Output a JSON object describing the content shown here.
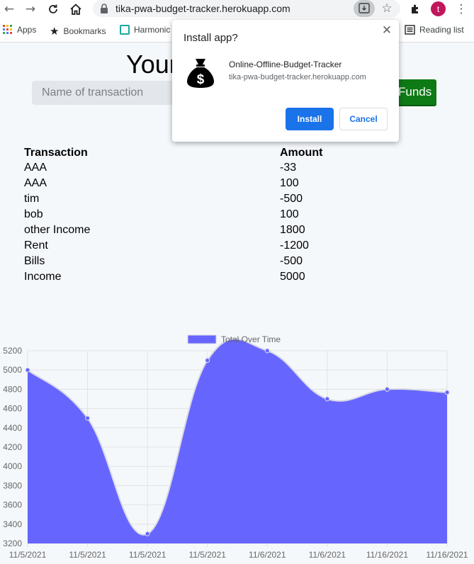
{
  "browser": {
    "url": "tika-pwa-budget-tracker.herokuapp.com",
    "profile_initial": "t",
    "bookmarks": [
      {
        "label": "Apps",
        "icon": "apps-grid-icon"
      },
      {
        "label": "Bookmarks",
        "icon": "star-icon"
      },
      {
        "label": "Harmonic",
        "icon": "harmonic-favicon-icon"
      }
    ],
    "reading_list_label": "Reading list"
  },
  "page": {
    "title": "Your",
    "name_placeholder": "Name of transaction",
    "add_funds_label": "Funds",
    "table": {
      "headers": [
        "Transaction",
        "Amount"
      ],
      "rows": [
        {
          "name": "AAA",
          "amount": "-33"
        },
        {
          "name": "AAA",
          "amount": "100"
        },
        {
          "name": "tim",
          "amount": "-500"
        },
        {
          "name": "bob",
          "amount": "100"
        },
        {
          "name": "other Income",
          "amount": "1800"
        },
        {
          "name": "Rent",
          "amount": "-1200"
        },
        {
          "name": "Bills",
          "amount": "-500"
        },
        {
          "name": "Income",
          "amount": "5000"
        }
      ]
    }
  },
  "chart_data": {
    "type": "area",
    "title": "",
    "legend": "top-center",
    "series": [
      {
        "name": "Total Over Time",
        "color": "#6666ff",
        "values": [
          5000,
          4500,
          3300,
          5100,
          5200,
          4700,
          4800,
          4767
        ]
      }
    ],
    "categories": [
      "11/5/2021",
      "11/5/2021",
      "11/5/2021",
      "11/5/2021",
      "11/6/2021",
      "11/6/2021",
      "11/16/2021",
      "11/16/2021"
    ],
    "y_ticks": [
      "5200",
      "5000",
      "4800",
      "4600",
      "4400",
      "4200",
      "4000",
      "3800",
      "3600",
      "3400",
      "3200"
    ],
    "ylim": [
      3200,
      5200
    ],
    "grid": true
  },
  "install_dialog": {
    "title": "Install app?",
    "app_name": "Online-Offline-Budget-Tracker",
    "origin": "tika-pwa-budget-tracker.herokuapp.com",
    "install_label": "Install",
    "cancel_label": "Cancel",
    "accent": "#1a73e8"
  }
}
